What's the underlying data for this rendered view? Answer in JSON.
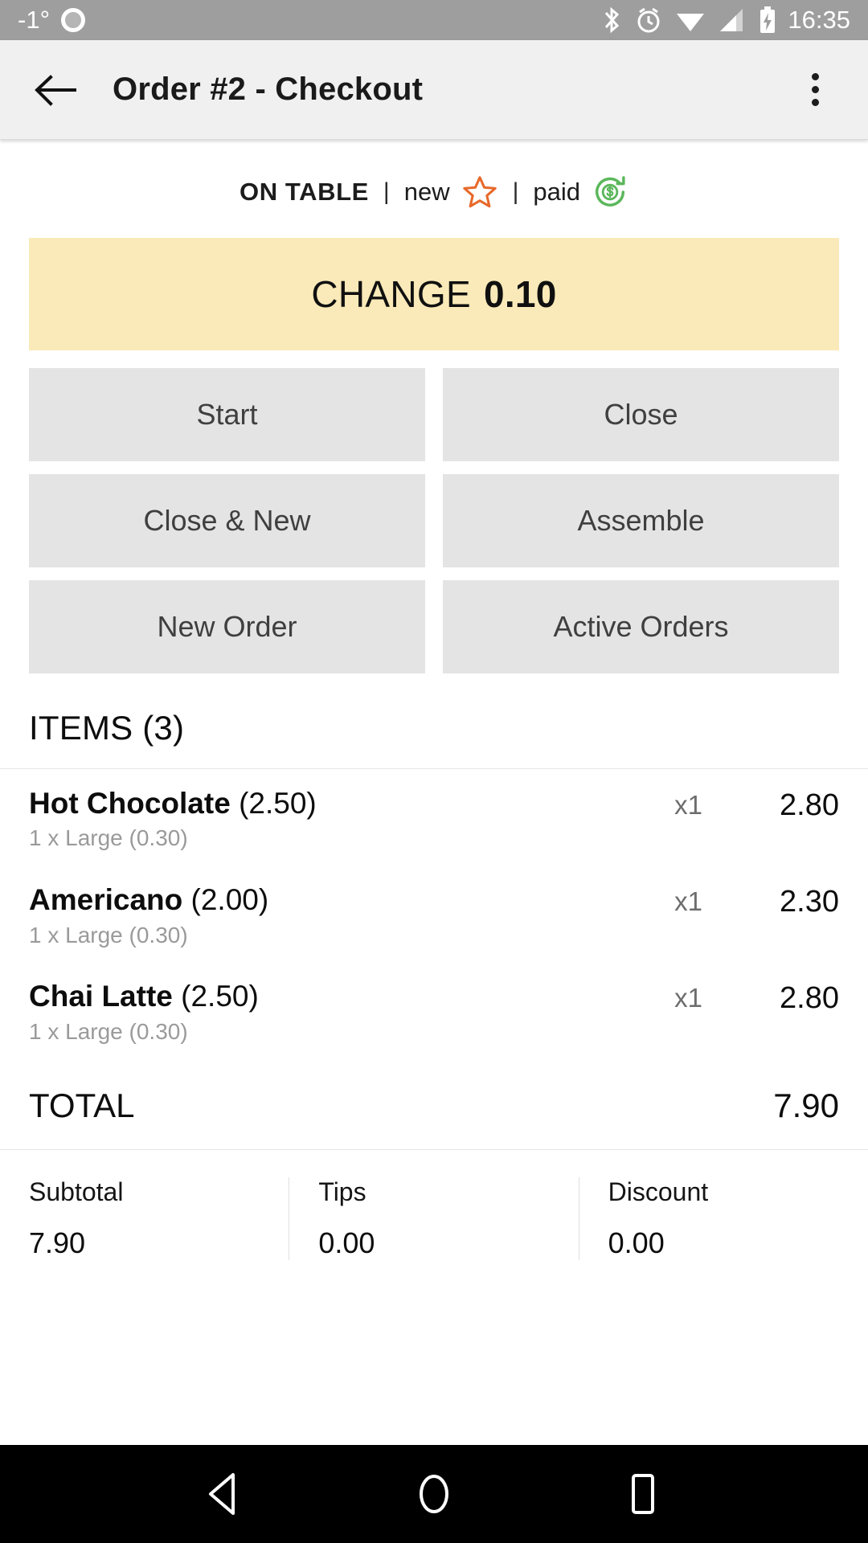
{
  "status_bar": {
    "temperature": "-1°",
    "weather_icon": "weather-circle-icon",
    "icons": [
      "bluetooth-icon",
      "alarm-icon",
      "wifi-icon",
      "signal-icon",
      "battery-charging-icon"
    ],
    "clock": "16:35"
  },
  "app_bar": {
    "back_icon": "back-arrow-icon",
    "title": "Order #2 - Checkout",
    "overflow_icon": "more-vertical-icon"
  },
  "order_status": {
    "state": "ON TABLE",
    "separator": "|",
    "new_label": "new",
    "new_icon": "star-outline-icon",
    "paid_label": "paid",
    "paid_icon": "refund-dollar-icon",
    "star_color": "#e8692a",
    "paid_color": "#5bb75b"
  },
  "change_banner": {
    "label": "CHANGE",
    "amount": "0.10",
    "background": "#faeab9"
  },
  "actions": [
    {
      "label": "Start",
      "name": "start-button"
    },
    {
      "label": "Close",
      "name": "close-button"
    },
    {
      "label": "Close & New",
      "name": "close-and-new-button"
    },
    {
      "label": "Assemble",
      "name": "assemble-button"
    },
    {
      "label": "New Order",
      "name": "new-order-button"
    },
    {
      "label": "Active Orders",
      "name": "active-orders-button"
    }
  ],
  "items_section": {
    "header": "ITEMS (3)",
    "items": [
      {
        "name": "Hot Chocolate",
        "base_price": "(2.50)",
        "modifier": "1 x Large (0.30)",
        "qty": "x1",
        "price": "2.80"
      },
      {
        "name": "Americano",
        "base_price": "(2.00)",
        "modifier": "1 x Large (0.30)",
        "qty": "x1",
        "price": "2.30"
      },
      {
        "name": "Chai Latte",
        "base_price": "(2.50)",
        "modifier": "1 x Large (0.30)",
        "qty": "x1",
        "price": "2.80"
      }
    ]
  },
  "total": {
    "label": "TOTAL",
    "value": "7.90"
  },
  "summary": [
    {
      "label": "Subtotal",
      "value": "7.90"
    },
    {
      "label": "Tips",
      "value": "0.00"
    },
    {
      "label": "Discount",
      "value": "0.00"
    }
  ],
  "nav_bar": {
    "back": "nav-back-icon",
    "home": "nav-home-icon",
    "recents": "nav-recents-icon"
  }
}
